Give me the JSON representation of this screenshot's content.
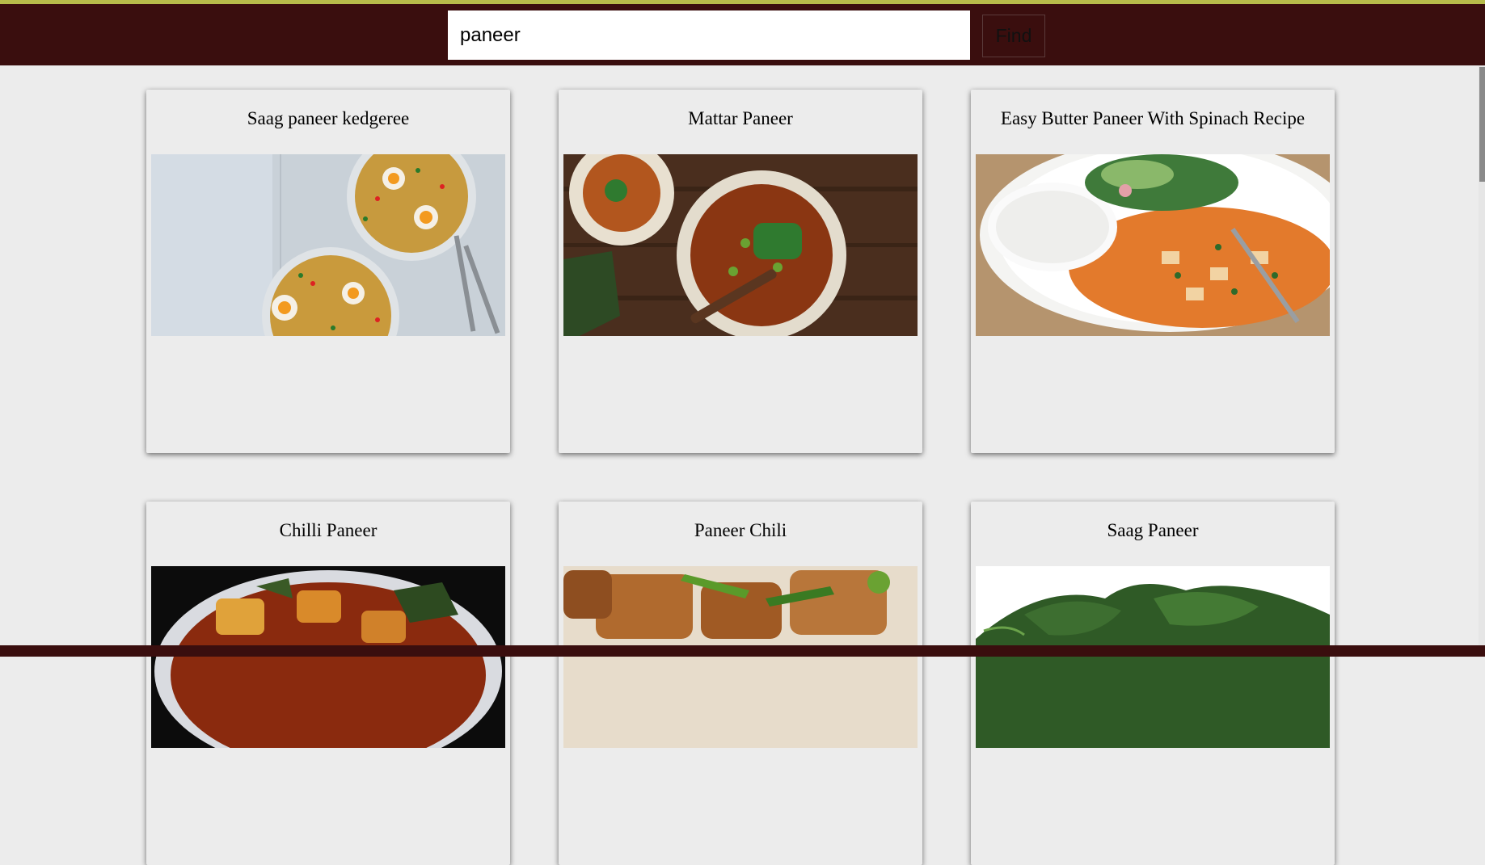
{
  "search": {
    "value": "paneer"
  },
  "toolbar": {
    "find_label": "Find"
  },
  "recipes": [
    {
      "title": "Saag paneer kedgeree"
    },
    {
      "title": "Mattar Paneer"
    },
    {
      "title": "Easy Butter Paneer With Spinach Recipe"
    },
    {
      "title": "Chilli Paneer"
    },
    {
      "title": "Paneer Chili"
    },
    {
      "title": "Saag Paneer"
    }
  ],
  "colors": {
    "header": "#3a0e0e",
    "accent": "#b7bc4a",
    "background": "#ececec",
    "card": "#ececec"
  }
}
